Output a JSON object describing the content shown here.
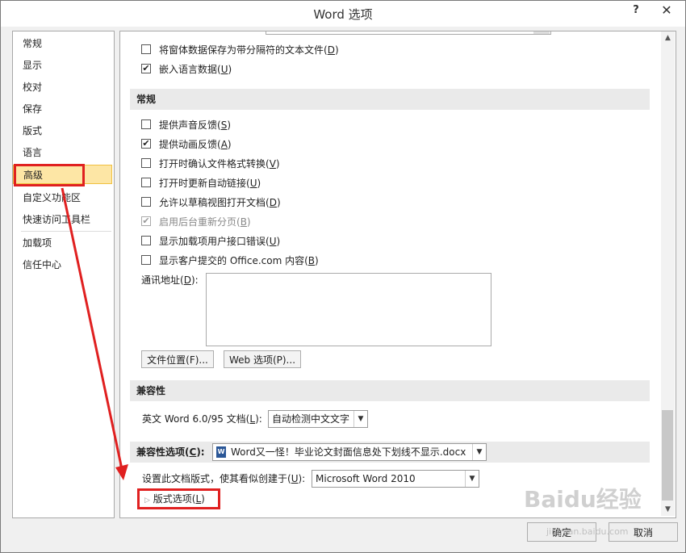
{
  "window": {
    "title": "Word 选项",
    "help": "?",
    "close": "✕"
  },
  "nav": {
    "items": [
      "常规",
      "显示",
      "校对",
      "保存",
      "版式",
      "语言",
      "高级",
      "自定义功能区",
      "快速访问工具栏",
      "加载项",
      "信任中心"
    ],
    "active_index": 6
  },
  "content": {
    "top_rows": [
      {
        "label": "将窗体数据保存为带分隔符的文本文件(",
        "key": "D",
        "suffix": ")",
        "checked": false
      },
      {
        "label": "嵌入语言数据(",
        "key": "U",
        "suffix": ")",
        "checked": true
      }
    ],
    "general": {
      "title": "常规",
      "rows": [
        {
          "label": "提供声音反馈(",
          "key": "S",
          "suffix": ")",
          "checked": false,
          "disabled": false
        },
        {
          "label": "提供动画反馈(",
          "key": "A",
          "suffix": ")",
          "checked": true,
          "disabled": false
        },
        {
          "label": "打开时确认文件格式转换(",
          "key": "V",
          "suffix": ")",
          "checked": false,
          "disabled": false
        },
        {
          "label": "打开时更新自动链接(",
          "key": "U",
          "suffix": ")",
          "checked": false,
          "disabled": false
        },
        {
          "label": "允许以草稿视图打开文档(",
          "key": "D",
          "suffix": ")",
          "checked": false,
          "disabled": false
        },
        {
          "label": "启用后台重新分页(",
          "key": "B",
          "suffix": ")",
          "checked": true,
          "disabled": true
        },
        {
          "label": "显示加载项用户接口错误(",
          "key": "U",
          "suffix": ")",
          "checked": false,
          "disabled": false
        },
        {
          "label": "显示客户提交的 Office.com 内容(",
          "key": "B",
          "suffix": ")",
          "checked": false,
          "disabled": false
        }
      ],
      "mail_address_label": "通讯地址(",
      "mail_address_key": "D",
      "mail_address_suffix": "):",
      "file_location_button": "文件位置(F)...",
      "web_options_button": "Web 选项(P)..."
    },
    "compat": {
      "title": "兼容性",
      "english_word_label": "英文 Word 6.0/95 文档(",
      "english_word_key": "L",
      "english_word_suffix": "):",
      "english_word_value": "自动检测中文文字",
      "compat_options_label": "兼容性选项(",
      "compat_options_key": "C",
      "compat_options_suffix": "):",
      "compat_doc_value": "Word又一怪！毕业论文封面信息处下划线不显示.docx",
      "layout_label": "设置此文档版式，使其看似创建于(",
      "layout_key": "U",
      "layout_suffix": "):",
      "layout_value": "Microsoft Word 2010",
      "layout_options": "版式选项(",
      "layout_options_key": "L",
      "layout_options_suffix": ")"
    }
  },
  "footer": {
    "ok": "确定",
    "cancel": "取消"
  },
  "watermark": {
    "main": "Baidu经验",
    "sub": "jingyan.baidu.com"
  },
  "colors": {
    "annotation_red": "#e02020",
    "active_nav": "#fde6a5"
  }
}
